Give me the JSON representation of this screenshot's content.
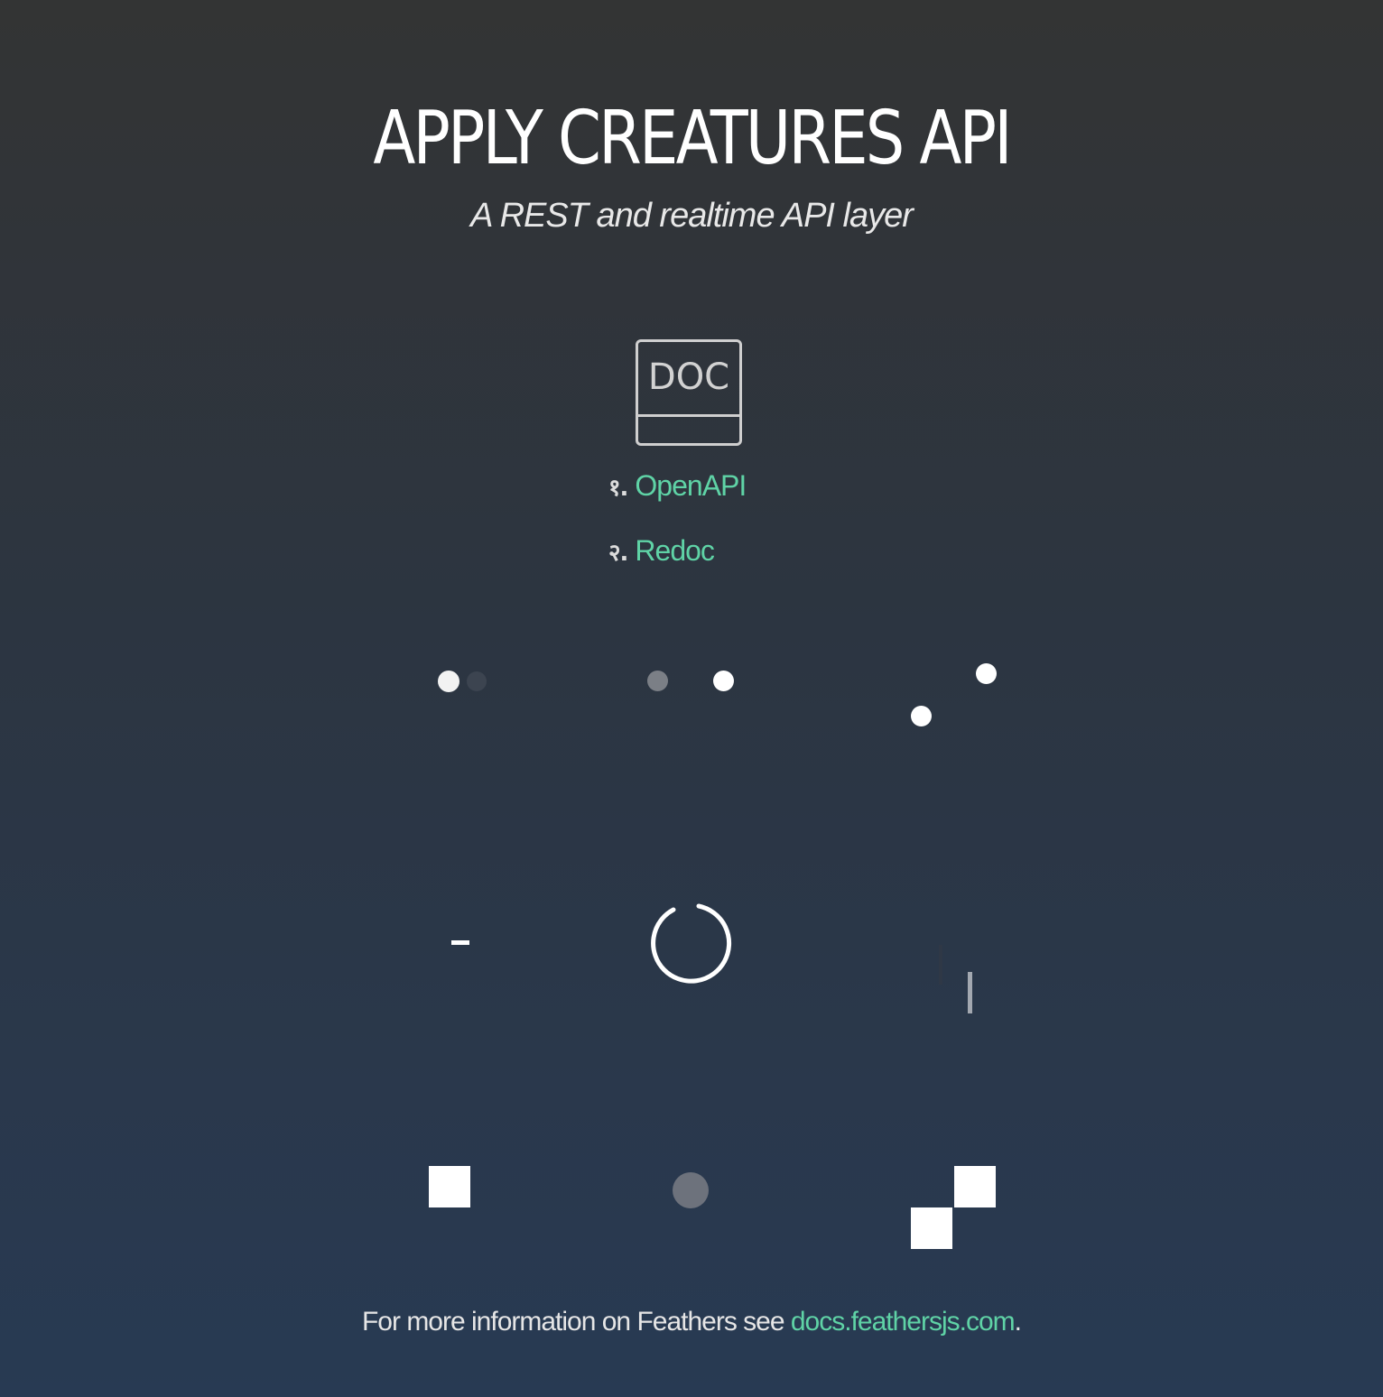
{
  "header": {
    "title": "APPLY CREATURES API",
    "subtitle": "A REST and realtime API layer"
  },
  "doc_icon": {
    "label": "DOC",
    "icon": "document-icon"
  },
  "links": [
    {
      "number": "१.",
      "label": "OpenAPI"
    },
    {
      "number": "२.",
      "label": "Redoc"
    }
  ],
  "footer": {
    "text": "For more information on Feathers see ",
    "link_label": "docs.feathersjs.com",
    "suffix": "."
  },
  "colors": {
    "accent": "#5fd3a6",
    "background_top": "#333434",
    "background_bottom": "#283a53",
    "spinner_white": "#ffffff",
    "spinner_gray": "#6d727c"
  }
}
